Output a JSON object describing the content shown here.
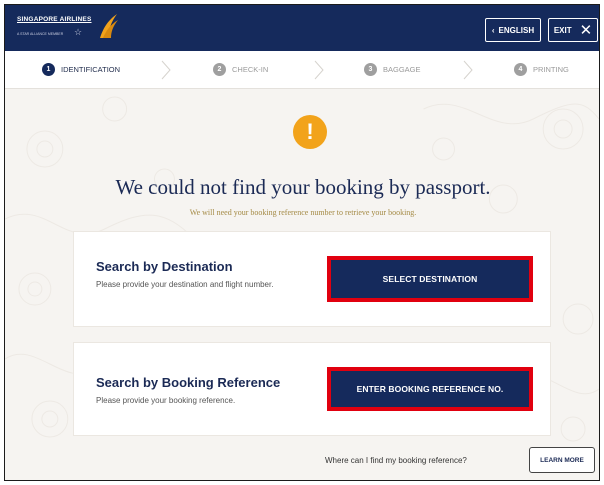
{
  "header": {
    "logo": {
      "name": "SINGAPORE AIRLINES",
      "tagline": "A STAR ALLIANCE MEMBER"
    },
    "language_button": {
      "label": "ENGLISH",
      "icon": "chevron-left-icon"
    },
    "exit_button": {
      "label": "EXIT",
      "icon": "close-icon"
    }
  },
  "steps": [
    {
      "number": "1",
      "label": "IDENTIFICATION",
      "active": true
    },
    {
      "number": "2",
      "label": "CHECK-IN",
      "active": false
    },
    {
      "number": "3",
      "label": "BAGGAGE",
      "active": false
    },
    {
      "number": "4",
      "label": "PRINTING",
      "active": false
    }
  ],
  "main": {
    "alert_icon": "!",
    "title": "We could not find your booking by passport.",
    "subtitle": "We will need your booking reference number to retrieve your booking."
  },
  "cards": [
    {
      "title": "Search by Destination",
      "description": "Please provide your destination and flight number.",
      "button_label": "SELECT DESTINATION"
    },
    {
      "title": "Search by Booking Reference",
      "description": "Please provide your booking reference.",
      "button_label": "ENTER BOOKING REFERENCE NO."
    }
  ],
  "footer": {
    "help_text": "Where can I find my booking reference?",
    "learn_more_label": "LEARN MORE"
  },
  "colors": {
    "brand_navy": "#152a5c",
    "alert_orange": "#f2a31b",
    "highlight_red": "#e1000f",
    "gold": "#a48a45"
  }
}
